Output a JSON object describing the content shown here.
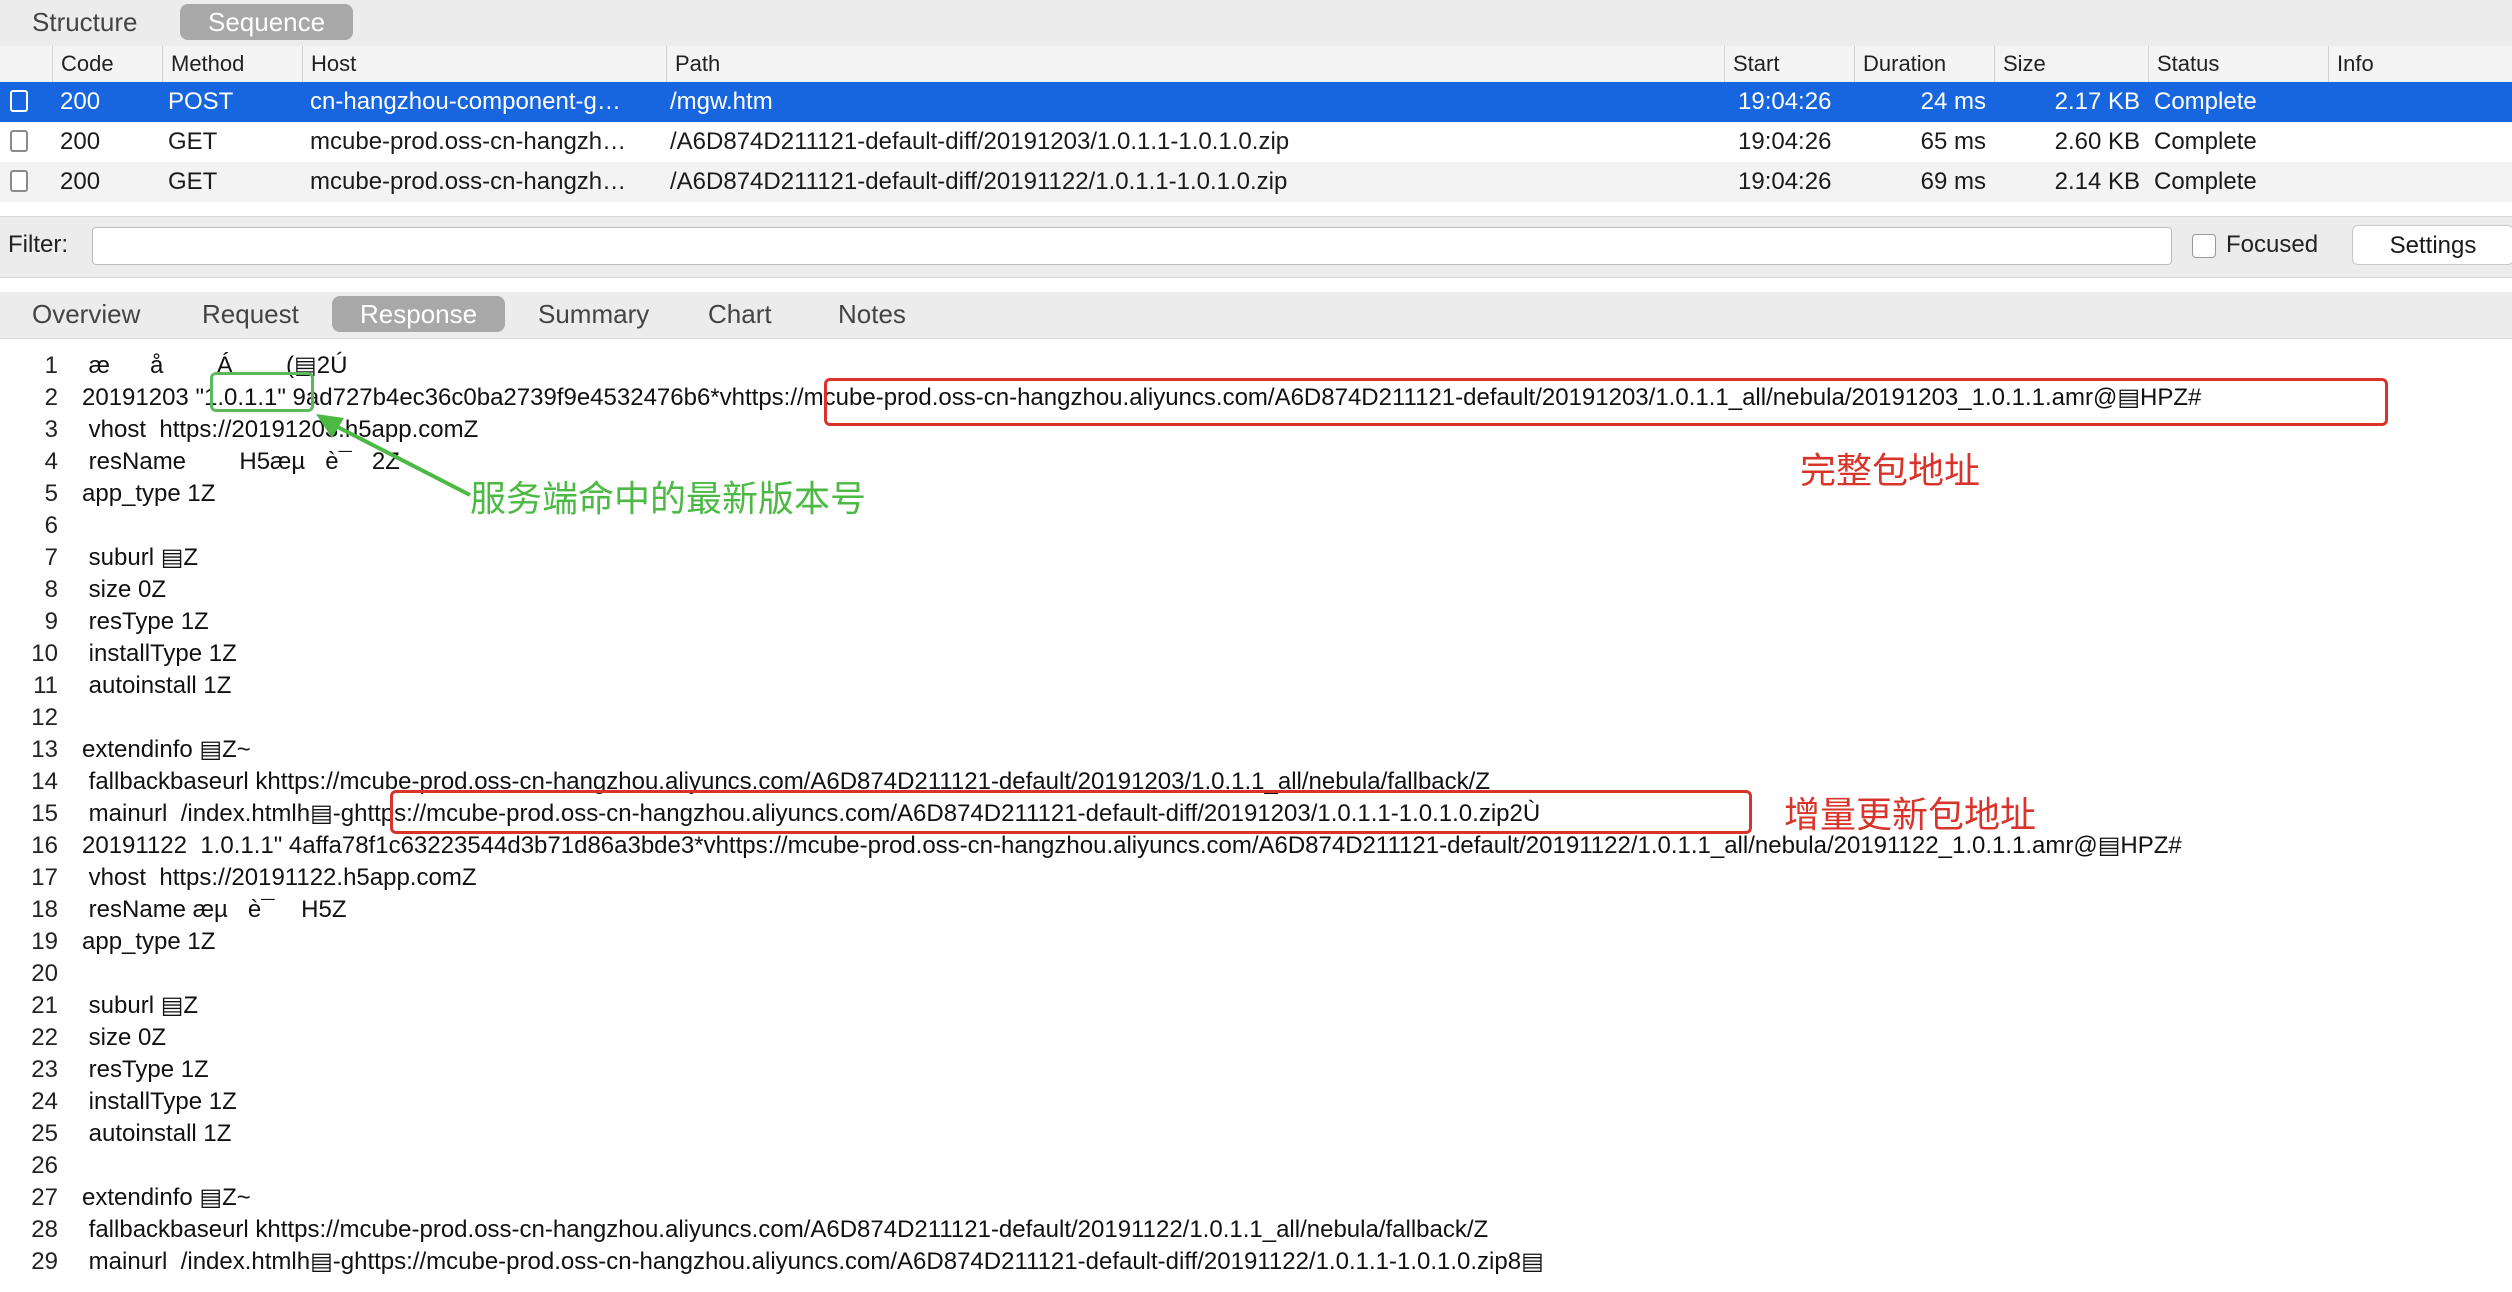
{
  "top_tabs": [
    {
      "label": "Structure"
    },
    {
      "label": "Sequence"
    }
  ],
  "table": {
    "columns": [
      "Code",
      "Method",
      "Host",
      "Path",
      "Start",
      "Duration",
      "Size",
      "Status",
      "Info"
    ],
    "rows": [
      {
        "code": "200",
        "method": "POST",
        "host": "cn-hangzhou-component-g…",
        "path": "/mgw.htm",
        "start": "19:04:26",
        "duration": "24 ms",
        "size": "2.17 KB",
        "status": "Complete",
        "info": ""
      },
      {
        "code": "200",
        "method": "GET",
        "host": "mcube-prod.oss-cn-hangzh…",
        "path": "/A6D874D211121-default-diff/20191203/1.0.1.1-1.0.1.0.zip",
        "start": "19:04:26",
        "duration": "65 ms",
        "size": "2.60 KB",
        "status": "Complete",
        "info": ""
      },
      {
        "code": "200",
        "method": "GET",
        "host": "mcube-prod.oss-cn-hangzh…",
        "path": "/A6D874D211121-default-diff/20191122/1.0.1.1-1.0.1.0.zip",
        "start": "19:04:26",
        "duration": "69 ms",
        "size": "2.14 KB",
        "status": "Complete",
        "info": ""
      }
    ]
  },
  "filter": {
    "label": "Filter:",
    "value": "",
    "focused_label": "Focused",
    "settings_label": "Settings"
  },
  "detail_tabs": [
    {
      "label": "Overview"
    },
    {
      "label": "Request"
    },
    {
      "label": "Response"
    },
    {
      "label": "Summary"
    },
    {
      "label": "Chart"
    },
    {
      "label": "Notes"
    }
  ],
  "response_lines": [
    {
      "n": "1",
      "text": " æ      å        Á        (▤2Ú"
    },
    {
      "n": "2",
      "text": "20191203 \"1.0.1.1\" 9ad727b4ec36c0ba2739f9e4532476b6*vhttps://mcube-prod.oss-cn-hangzhou.aliyuncs.com/A6D874D211121-default/20191203/1.0.1.1_all/nebula/20191203_1.0.1.1.amr@▤HPZ#"
    },
    {
      "n": "3",
      "text": " vhost  https://20191203.h5app.comZ"
    },
    {
      "n": "4",
      "text": " resName        H5æµ   è¯   2Z"
    },
    {
      "n": "5",
      "text": "app_type 1Z"
    },
    {
      "n": "6",
      "text": ""
    },
    {
      "n": "7",
      "text": " suburl ▤Z"
    },
    {
      "n": "8",
      "text": " size 0Z"
    },
    {
      "n": "9",
      "text": " resType 1Z"
    },
    {
      "n": "10",
      "text": " installType 1Z"
    },
    {
      "n": "11",
      "text": " autoinstall 1Z"
    },
    {
      "n": "12",
      "text": ""
    },
    {
      "n": "13",
      "text": "extendinfo ▤Z~"
    },
    {
      "n": "14",
      "text": " fallbackbaseurl khttps://mcube-prod.oss-cn-hangzhou.aliyuncs.com/A6D874D211121-default/20191203/1.0.1.1_all/nebula/fallback/Z"
    },
    {
      "n": "15",
      "text": " mainurl  /index.htmlh▤-ghttps://mcube-prod.oss-cn-hangzhou.aliyuncs.com/A6D874D211121-default-diff/20191203/1.0.1.1-1.0.1.0.zip2Ù"
    },
    {
      "n": "16",
      "text": "20191122  1.0.1.1\" 4affa78f1c63223544d3b71d86a3bde3*vhttps://mcube-prod.oss-cn-hangzhou.aliyuncs.com/A6D874D211121-default/20191122/1.0.1.1_all/nebula/20191122_1.0.1.1.amr@▤HPZ#"
    },
    {
      "n": "17",
      "text": " vhost  https://20191122.h5app.comZ"
    },
    {
      "n": "18",
      "text": " resName æµ   è¯    H5Z"
    },
    {
      "n": "19",
      "text": "app_type 1Z"
    },
    {
      "n": "20",
      "text": ""
    },
    {
      "n": "21",
      "text": " suburl ▤Z"
    },
    {
      "n": "22",
      "text": " size 0Z"
    },
    {
      "n": "23",
      "text": " resType 1Z"
    },
    {
      "n": "24",
      "text": " installType 1Z"
    },
    {
      "n": "25",
      "text": " autoinstall 1Z"
    },
    {
      "n": "26",
      "text": ""
    },
    {
      "n": "27",
      "text": "extendinfo ▤Z~"
    },
    {
      "n": "28",
      "text": " fallbackbaseurl khttps://mcube-prod.oss-cn-hangzhou.aliyuncs.com/A6D874D211121-default/20191122/1.0.1.1_all/nebula/fallback/Z"
    },
    {
      "n": "29",
      "text": " mainurl  /index.htmlh▤-ghttps://mcube-prod.oss-cn-hangzhou.aliyuncs.com/A6D874D211121-default-diff/20191122/1.0.1.1-1.0.1.0.zip8▤"
    }
  ],
  "annotations": {
    "latest_version": "服务端命中的最新版本号",
    "full_package": "完整包地址",
    "incremental_package": "增量更新包地址"
  },
  "colors": {
    "selection": "#1766e0",
    "annotation_red": "#d9342b",
    "annotation_green": "#4cb944"
  }
}
